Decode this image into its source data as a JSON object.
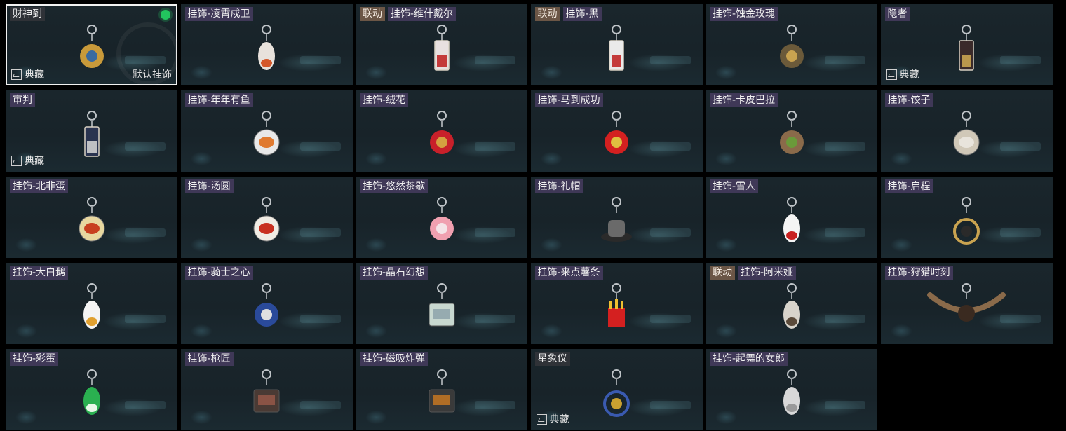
{
  "items": [
    {
      "labels": [
        "财神到"
      ],
      "tag_style": "plain",
      "collection": "典藏",
      "default": "默认挂饰",
      "equipped": true,
      "selected": true,
      "icon": "fortune-god-charm-icon",
      "colors": [
        "#c99a3a",
        "#3a6aa0"
      ]
    },
    {
      "labels": [
        "挂饰-凌霄戍卫"
      ],
      "icon": "rocket-charm-icon",
      "colors": [
        "#e8e2dc",
        "#d4582a"
      ]
    },
    {
      "labels": [
        "联动",
        "挂饰-维什戴尔"
      ],
      "icon": "card-charm-icon",
      "colors": [
        "#e8e0e0",
        "#c02828"
      ]
    },
    {
      "labels": [
        "联动",
        "挂饰-黑"
      ],
      "icon": "card-charm-icon",
      "colors": [
        "#eaeaea",
        "#c02828"
      ]
    },
    {
      "labels": [
        "挂饰-蚀金玫瑰"
      ],
      "icon": "gold-rose-charm-icon",
      "colors": [
        "#6b5a3a",
        "#c9a350"
      ]
    },
    {
      "labels": [
        "隐者"
      ],
      "collection": "典藏",
      "icon": "tarot-card-icon",
      "colors": [
        "#3a2a2a",
        "#c9a350"
      ]
    },
    {
      "labels": [
        "审判"
      ],
      "collection": "典藏",
      "icon": "tarot-card-icon",
      "colors": [
        "#2a3450",
        "#cfcfcf"
      ]
    },
    {
      "labels": [
        "挂饰-年年有鱼"
      ],
      "icon": "fish-plate-charm-icon",
      "colors": [
        "#e07a30",
        "#e8e8e8"
      ]
    },
    {
      "labels": [
        "挂饰-绒花"
      ],
      "icon": "red-flower-charm-icon",
      "colors": [
        "#c8202a",
        "#d4a040"
      ]
    },
    {
      "labels": [
        "挂饰-马到成功"
      ],
      "icon": "red-horse-charm-icon",
      "colors": [
        "#d42020",
        "#e0c040"
      ]
    },
    {
      "labels": [
        "挂饰-卡皮巴拉"
      ],
      "icon": "capybara-charm-icon",
      "colors": [
        "#8a6a4a",
        "#6a9a3a"
      ]
    },
    {
      "labels": [
        "挂饰-饺子"
      ],
      "icon": "dumpling-plate-charm-icon",
      "colors": [
        "#e8e4dc",
        "#d0c8b8"
      ]
    },
    {
      "labels": [
        "挂饰-北非蛋"
      ],
      "icon": "shakshuka-pan-charm-icon",
      "colors": [
        "#c84020",
        "#e8d8a0"
      ]
    },
    {
      "labels": [
        "挂饰-汤圆"
      ],
      "icon": "tangyuan-bowl-charm-icon",
      "colors": [
        "#c83020",
        "#f0ece4"
      ]
    },
    {
      "labels": [
        "挂饰-悠然茶歇"
      ],
      "icon": "cupcake-charm-icon",
      "colors": [
        "#f0a0b0",
        "#f4e4e8"
      ]
    },
    {
      "labels": [
        "挂饰-礼帽"
      ],
      "icon": "top-hat-charm-icon",
      "colors": [
        "#6a6a6a",
        "#2a2a2a"
      ]
    },
    {
      "labels": [
        "挂饰-雪人"
      ],
      "icon": "snowman-charm-icon",
      "colors": [
        "#f4f4f4",
        "#c82020"
      ]
    },
    {
      "labels": [
        "挂饰-启程"
      ],
      "icon": "compass-ring-charm-icon",
      "colors": [
        "#2a2a2a",
        "#c9a350"
      ]
    },
    {
      "labels": [
        "挂饰-大白鹅"
      ],
      "icon": "goose-charm-icon",
      "colors": [
        "#f4f4f4",
        "#e0a030"
      ]
    },
    {
      "labels": [
        "挂饰-骑士之心"
      ],
      "icon": "knight-heart-charm-icon",
      "colors": [
        "#2a4a9a",
        "#e0e0e0"
      ]
    },
    {
      "labels": [
        "挂饰-晶石幻想"
      ],
      "icon": "crystal-cube-charm-icon",
      "colors": [
        "#c8d8d0",
        "#8aa0a8"
      ]
    },
    {
      "labels": [
        "挂饰-来点薯条"
      ],
      "icon": "fries-charm-icon",
      "colors": [
        "#d42020",
        "#f0c030"
      ]
    },
    {
      "labels": [
        "联动",
        "挂饰-阿米娅"
      ],
      "icon": "rabbit-charm-icon",
      "colors": [
        "#d8d4cc",
        "#5a4a3a"
      ]
    },
    {
      "labels": [
        "挂饰-狩猎时刻"
      ],
      "icon": "antler-charm-icon",
      "colors": [
        "#8a6a4a",
        "#3a2a20"
      ]
    },
    {
      "labels": [
        "挂饰-彩蛋"
      ],
      "icon": "green-egg-charm-icon",
      "colors": [
        "#2ab050",
        "#e8f8e8"
      ]
    },
    {
      "labels": [
        "挂饰-枪匠"
      ],
      "icon": "gunsmith-case-charm-icon",
      "colors": [
        "#4a3a34",
        "#9a5a4a"
      ]
    },
    {
      "labels": [
        "挂饰-磁吸炸弹"
      ],
      "icon": "magnetic-bomb-charm-icon",
      "colors": [
        "#3a3a3a",
        "#d07a20"
      ]
    },
    {
      "labels": [
        "星象仪"
      ],
      "tag_style": "plain",
      "collection": "典藏",
      "icon": "astrolabe-charm-icon",
      "colors": [
        "#c9a030",
        "#3a5ab0"
      ]
    },
    {
      "labels": [
        "挂饰-起舞的女郎"
      ],
      "icon": "dancer-figure-charm-icon",
      "colors": [
        "#d8d8d8",
        "#9a9a9a"
      ]
    }
  ]
}
